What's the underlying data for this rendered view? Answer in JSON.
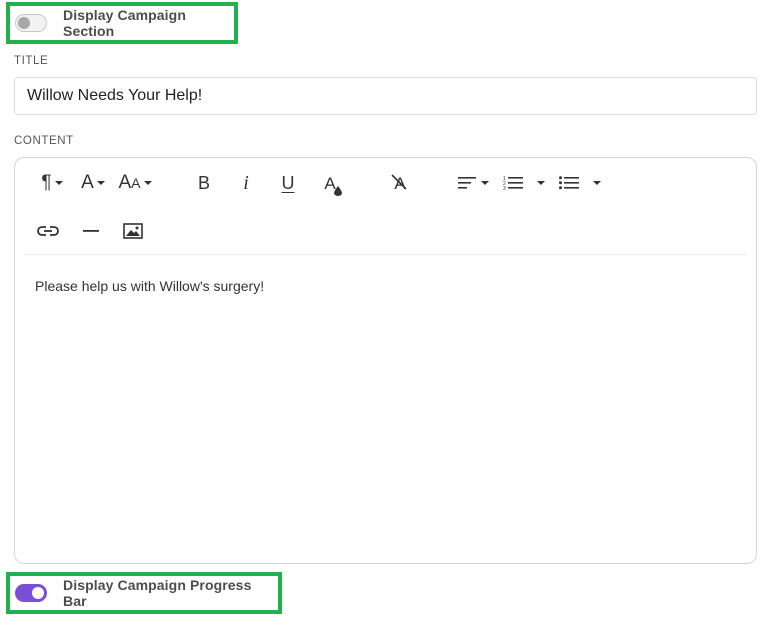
{
  "campaign_section_toggle": {
    "label": "Display Campaign Section",
    "enabled": false
  },
  "title_field": {
    "label": "TITLE",
    "value": "Willow Needs Your Help!"
  },
  "content_field": {
    "label": "CONTENT",
    "body_text": "Please help us with Willow's surgery!"
  },
  "toolbar": {
    "row1": [
      {
        "icon": "paragraph-icon",
        "has_dropdown": true
      },
      {
        "icon": "font-family-icon",
        "has_dropdown": true
      },
      {
        "icon": "font-size-icon",
        "has_dropdown": true
      },
      {
        "icon": "bold-icon"
      },
      {
        "icon": "italic-icon"
      },
      {
        "icon": "underline-icon"
      },
      {
        "icon": "text-color-icon"
      },
      {
        "icon": "clear-format-icon"
      },
      {
        "icon": "align-icon",
        "has_dropdown": true
      },
      {
        "icon": "ordered-list-icon",
        "has_dropdown": true
      },
      {
        "icon": "unordered-list-icon",
        "has_dropdown": true
      }
    ],
    "row2": [
      {
        "icon": "link-icon"
      },
      {
        "icon": "horizontal-rule-icon"
      },
      {
        "icon": "image-icon"
      }
    ],
    "glyphs": {
      "paragraph": "¶",
      "font": "A",
      "size_big": "A",
      "size_small": "A",
      "bold": "B",
      "italic": "i",
      "underline": "U",
      "color": "A",
      "clear": "A"
    }
  },
  "progress_bar_toggle": {
    "label": "Display Campaign Progress Bar",
    "enabled": true
  },
  "colors": {
    "highlight": "#22b14c",
    "toggle_on": "#7a4fd6"
  }
}
